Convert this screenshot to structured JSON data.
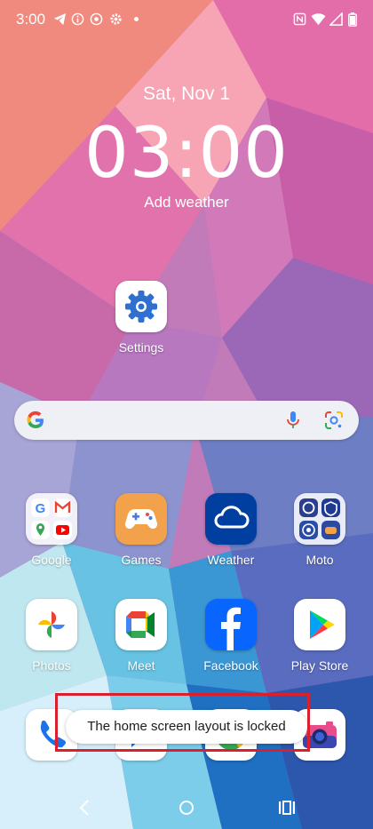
{
  "status_bar": {
    "time": "3:00",
    "icons": [
      "telegram-icon",
      "info-icon",
      "moto-icon",
      "settings-gear-icon",
      "dot-icon",
      "nfc-icon",
      "wifi-icon",
      "signal-icon",
      "battery-icon"
    ]
  },
  "lockscreen": {
    "date": "Sat, Nov 1",
    "time": "03:00",
    "weather_prompt": "Add weather"
  },
  "apps_top": [
    {
      "label": "Settings",
      "icon": "settings-gear-icon"
    }
  ],
  "search_bar": {
    "icons": [
      "google-g-icon",
      "microphone-icon",
      "google-lens-icon"
    ]
  },
  "apps_row1": [
    {
      "label": "Google",
      "icon": "google-folder-icon"
    },
    {
      "label": "Games",
      "icon": "games-controller-icon"
    },
    {
      "label": "Weather",
      "icon": "weather-cloud-icon"
    },
    {
      "label": "Moto",
      "icon": "moto-folder-icon"
    }
  ],
  "apps_row2": [
    {
      "label": "Photos",
      "icon": "photos-pinwheel-icon"
    },
    {
      "label": "Meet",
      "icon": "meet-camera-icon"
    },
    {
      "label": "Facebook",
      "icon": "facebook-f-icon"
    },
    {
      "label": "Play Store",
      "icon": "play-store-icon"
    }
  ],
  "dock": {
    "icons": [
      "phone-icon",
      "messages-icon",
      "chrome-icon",
      "camera-icon"
    ]
  },
  "toast": {
    "message": "The home screen layout is locked"
  },
  "nav_bar": {
    "icons": [
      "back-icon",
      "home-icon",
      "recents-icon"
    ]
  },
  "colors": {
    "highlight": "#d9202e",
    "search_bg": "#eef0f5",
    "weather_tile": "#003fa0",
    "facebook_tile": "#0866ff",
    "games_tile": "#f2a24b"
  }
}
